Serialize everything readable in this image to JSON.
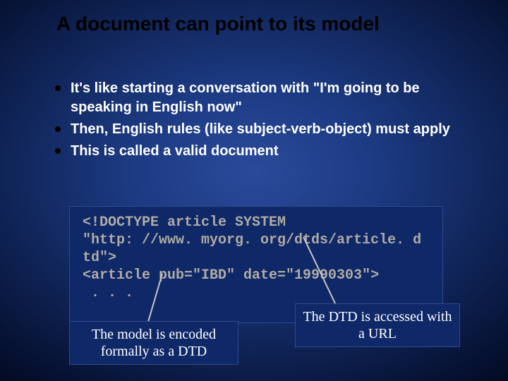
{
  "title": "A document can point to its model",
  "bullets": [
    "It's like starting a conversation with \"I'm going to be speaking in English now\"",
    "Then, English rules (like subject-verb-object) must apply",
    "This is called a valid document"
  ],
  "code": {
    "line1": "<!DOCTYPE article SYSTEM",
    "line2": "\"http: //www. myorg. org/dtds/article. d",
    "line3": "td\">",
    "line4": "<article pub=\"IBD\" date=\"19990303\">",
    "line5": " . . ."
  },
  "callouts": {
    "left": "The model is encoded formally as a DTD",
    "right": "The DTD is accessed with a URL"
  }
}
